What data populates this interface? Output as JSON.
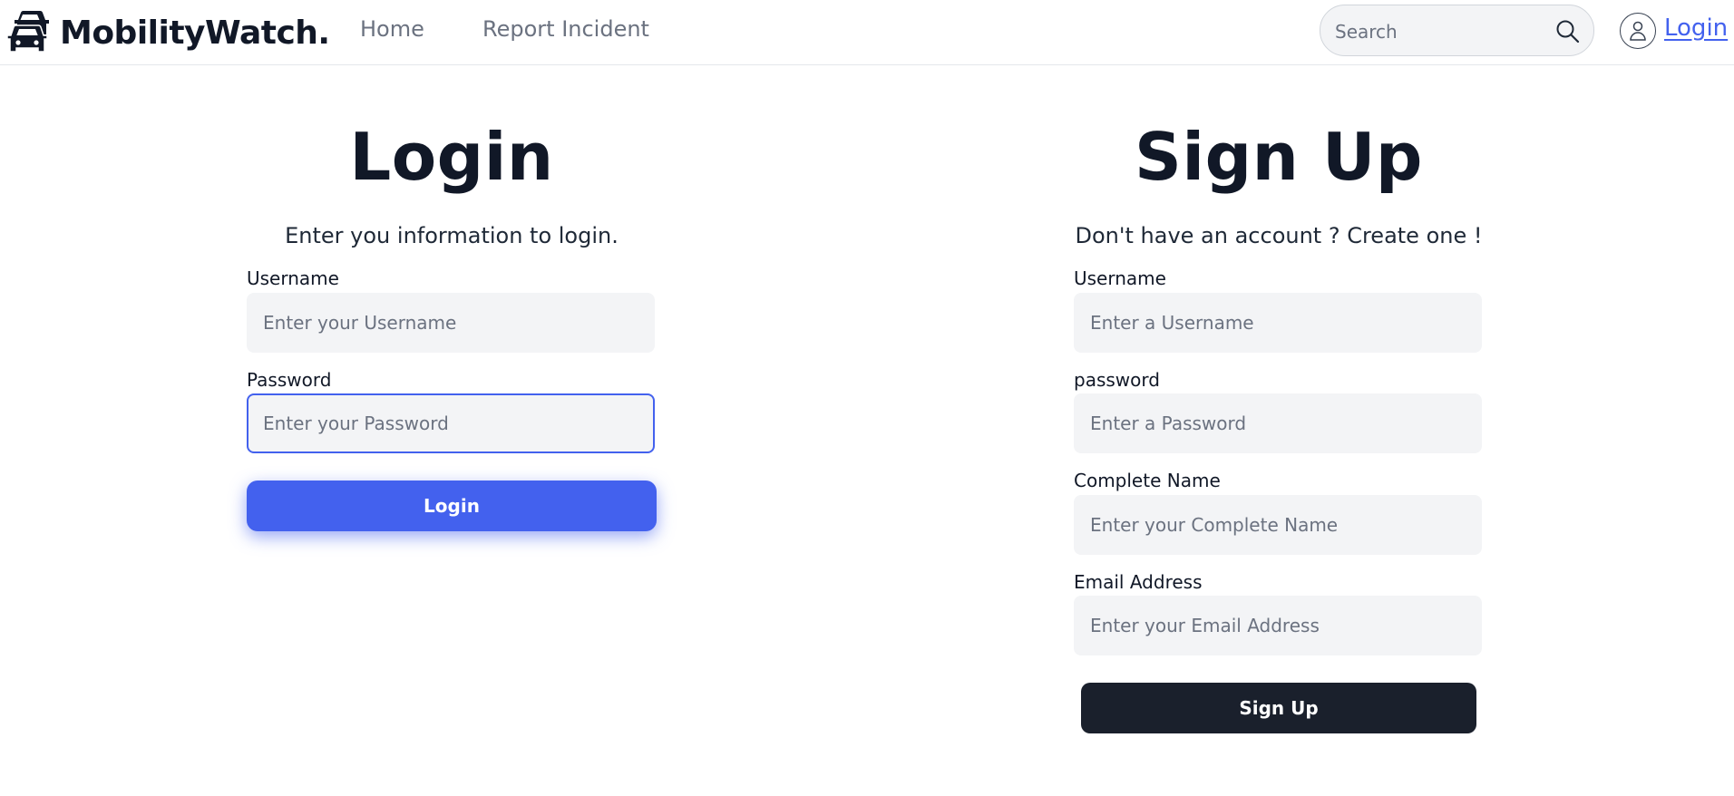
{
  "brand": {
    "name": "MobilityWatch.",
    "icon": "cars-traffic-icon"
  },
  "nav": {
    "links": [
      {
        "label": "Home"
      },
      {
        "label": "Report Incident"
      }
    ],
    "search": {
      "placeholder": "Search",
      "value": ""
    },
    "login_label": "Login"
  },
  "login_form": {
    "title": "Login",
    "subtitle": "Enter you information to login.",
    "fields": [
      {
        "label": "Username",
        "placeholder": "Enter your Username",
        "value": ""
      },
      {
        "label": "Password",
        "placeholder": "Enter your Password",
        "value": "",
        "focused": true
      }
    ],
    "submit_label": "Login"
  },
  "signup_form": {
    "title": "Sign Up",
    "subtitle": "Don't have an account ? Create one !",
    "fields": [
      {
        "label": "Username",
        "placeholder": "Enter a Username",
        "value": ""
      },
      {
        "label": "password",
        "placeholder": "Enter a Password",
        "value": ""
      },
      {
        "label": "Complete Name",
        "placeholder": "Enter your Complete Name",
        "value": ""
      },
      {
        "label": "Email Address",
        "placeholder": "Enter your Email Address",
        "value": ""
      }
    ],
    "submit_label": "Sign Up"
  },
  "colors": {
    "accent": "#4361ee",
    "dark_button": "#1a202c",
    "input_bg": "#f3f4f6",
    "nav_text": "#6b7280"
  }
}
